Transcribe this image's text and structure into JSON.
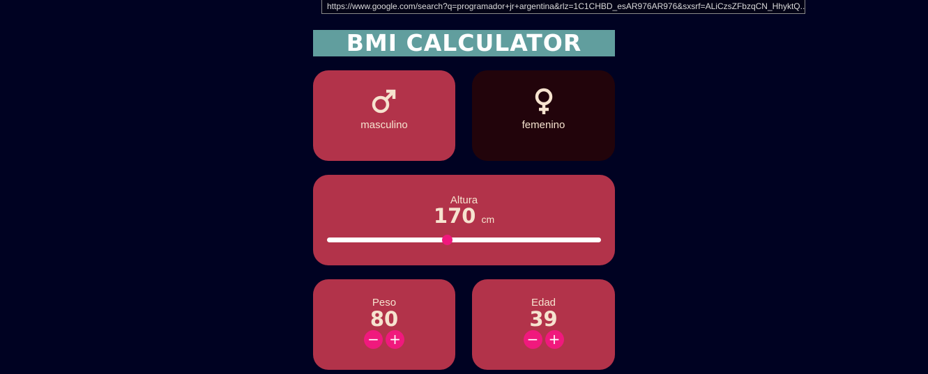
{
  "browser": {
    "status_url": "https://www.google.com/search?q=programador+jr+argentina&rlz=1C1CHBD_esAR976AR976&sxsrf=ALiCzsZFbzqCN_HhyktQ..."
  },
  "app": {
    "title": "BMI CALCULATOR"
  },
  "gender": {
    "male": {
      "label": "masculino",
      "icon": "male-icon",
      "selected": true
    },
    "female": {
      "label": "femenino",
      "icon": "female-icon",
      "selected": false
    }
  },
  "height": {
    "label": "Altura",
    "value": "170",
    "unit": "cm",
    "slider_fraction": 0.44
  },
  "weight": {
    "label": "Peso",
    "value": "80",
    "minus": "−",
    "plus": "+"
  },
  "age": {
    "label": "Edad",
    "value": "39",
    "minus": "−",
    "plus": "+"
  },
  "colors": {
    "background": "#000222",
    "title_bg": "#619e9e",
    "card_active": "#b2334a",
    "card_inactive": "#22040b",
    "accent": "#f0197d",
    "text": "#f6e3cf"
  }
}
